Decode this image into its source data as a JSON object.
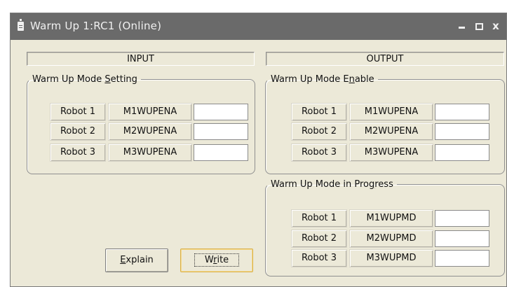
{
  "window": {
    "title": "Warm Up 1:RC1 (Online)",
    "icons": [
      "document-icon",
      "minimize-icon",
      "maximize-icon",
      "close-icon"
    ],
    "close_glyph": "x"
  },
  "input": {
    "header": "INPUT",
    "group": {
      "legend_pre": "Warm Up Mode ",
      "legend_mn": "S",
      "legend_post": "etting",
      "rows": [
        {
          "robot": "Robot 1",
          "signal": "M1WUPENA",
          "value": ""
        },
        {
          "robot": "Robot 2",
          "signal": "M2WUPENA",
          "value": ""
        },
        {
          "robot": "Robot 3",
          "signal": "M3WUPENA",
          "value": ""
        }
      ]
    }
  },
  "output": {
    "header": "OUTPUT",
    "enable": {
      "legend_pre": "Warm Up Mode E",
      "legend_mn": "n",
      "legend_post": "able",
      "rows": [
        {
          "robot": "Robot 1",
          "signal": "M1WUPENA",
          "value": ""
        },
        {
          "robot": "Robot 2",
          "signal": "M2WUPENA",
          "value": ""
        },
        {
          "robot": "Robot 3",
          "signal": "M3WUPENA",
          "value": ""
        }
      ]
    },
    "progress": {
      "legend_pre": "Warm Up Mode in Pro",
      "legend_mn": "g",
      "legend_post": "ress",
      "rows": [
        {
          "robot": "Robot 1",
          "signal": "M1WUPMD",
          "value": ""
        },
        {
          "robot": "Robot 2",
          "signal": "M2WUPMD",
          "value": ""
        },
        {
          "robot": "Robot 3",
          "signal": "M3WUPMD",
          "value": ""
        }
      ]
    }
  },
  "buttons": {
    "explain_mn": "E",
    "explain_rest": "xplain",
    "write_pre": "W",
    "write_mn": "r",
    "write_post": "ite"
  }
}
